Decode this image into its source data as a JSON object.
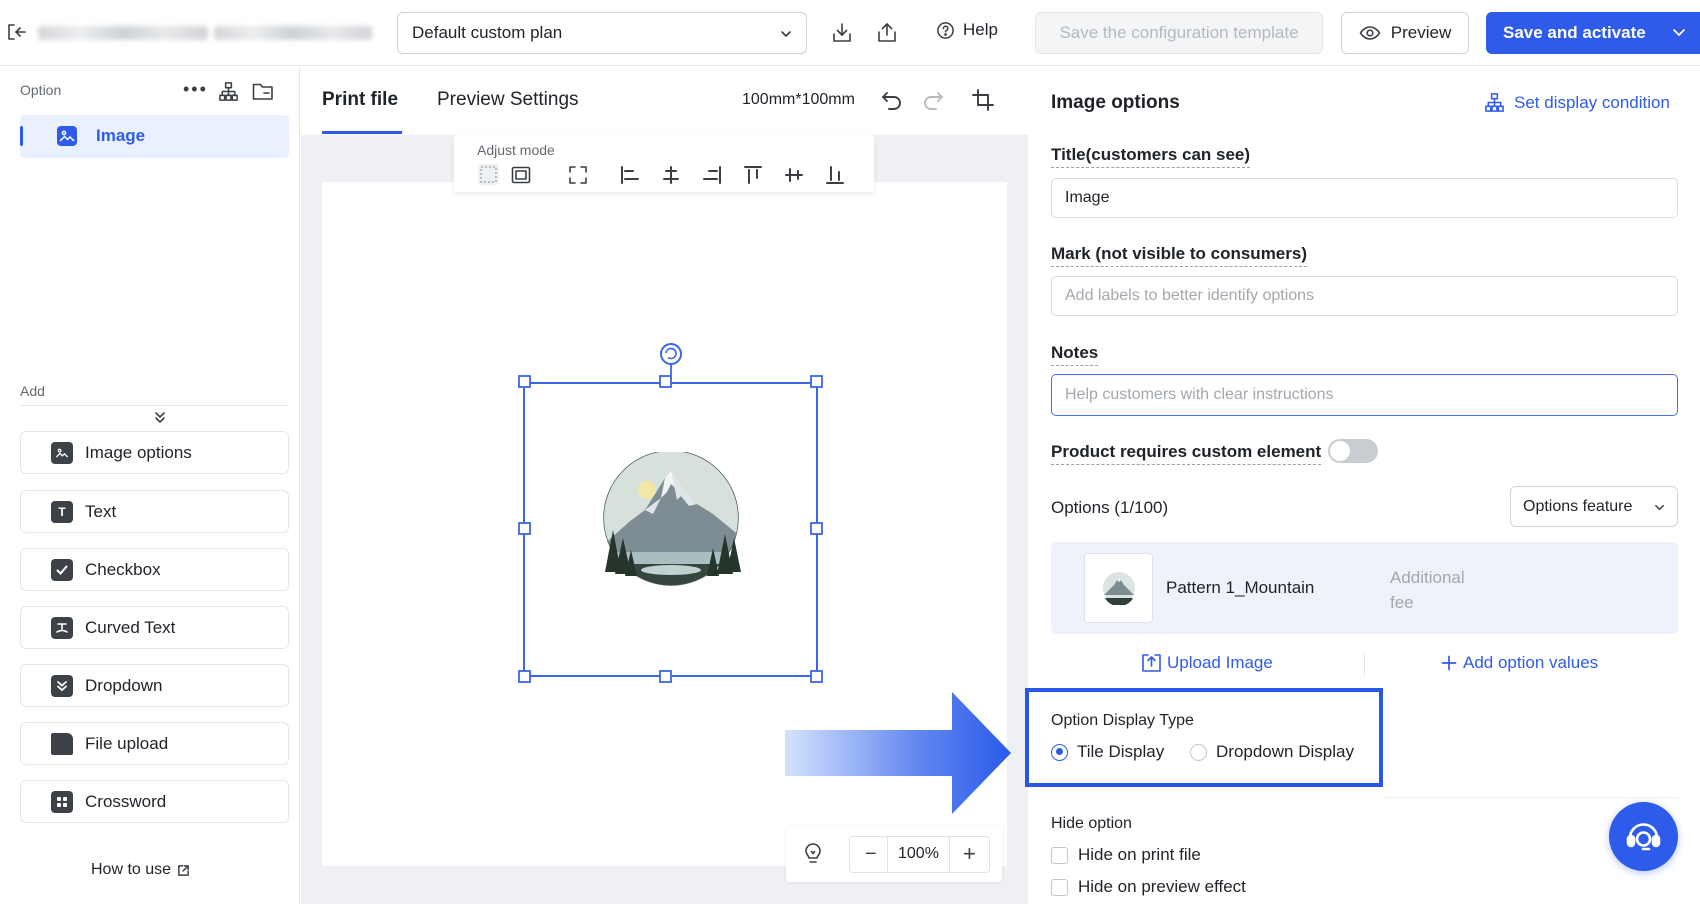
{
  "topbar": {
    "plan_select": "Default custom plan",
    "help": "Help",
    "save_template": "Save the configuration template",
    "preview": "Preview",
    "save_activate": "Save and activate"
  },
  "sidebar": {
    "option_heading": "Option",
    "active_item": "Image",
    "add_heading": "Add",
    "items": [
      "Image options",
      "Text",
      "Checkbox",
      "Curved Text",
      "Dropdown",
      "File upload",
      "Crossword"
    ],
    "how_to_use": "How to use"
  },
  "canvas": {
    "tabs": [
      "Print file",
      "Preview Settings"
    ],
    "size": "100mm*100mm",
    "adjust_mode": "Adjust mode",
    "zoom": "100%"
  },
  "panel": {
    "title": "Image options",
    "set_display_condition": "Set display condition",
    "title_label": "Title(customers can see)",
    "title_value": "Image",
    "mark_label": "Mark (not visible to consumers)",
    "mark_placeholder": "Add labels to better identify options",
    "notes_label": "Notes",
    "notes_placeholder": "Help customers with clear instructions",
    "custom_element_label": "Product requires custom element",
    "options_count": "Options (1/100)",
    "options_feature": "Options feature",
    "option_name": "Pattern 1_Mountain",
    "additional_fee": "Additional fee",
    "upload_image": "Upload Image",
    "add_option_values": "Add option values",
    "display_type_label": "Option Display Type",
    "tile_display": "Tile Display",
    "dropdown_display": "Dropdown Display",
    "hide_option_label": "Hide option",
    "hide_print": "Hide on print file",
    "hide_preview": "Hide on preview effect"
  },
  "colors": {
    "accent": "#2f5bea",
    "highlight_border": "#2856e6",
    "canvas_bg": "#eef0f3"
  }
}
